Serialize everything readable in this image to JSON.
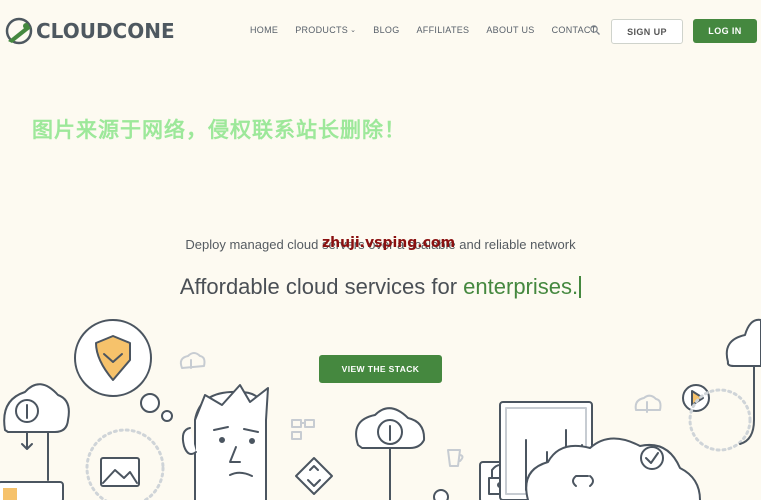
{
  "brand": {
    "name": "CLOUDCONE"
  },
  "nav": {
    "items": [
      "HOME",
      "PRODUCTS",
      "BLOG",
      "AFFILIATES",
      "ABOUT US",
      "CONTACT"
    ],
    "products_caret": "⌄",
    "search_icon": "search-icon",
    "signup_label": "SIGN UP",
    "login_label": "LOG IN"
  },
  "watermarks": {
    "cn_notice": "图片来源于网络，侵权联系站长删除！",
    "site_url": "zhuji.vsping.com"
  },
  "hero": {
    "tagline": "Deploy managed cloud servers over a scalable and reliable network",
    "headline_prefix": "Affordable cloud services for ",
    "headline_accent": "enterprises.",
    "cta_label": "VIEW THE STACK"
  },
  "colors": {
    "background": "#fdfaf1",
    "brand_green": "#45883f",
    "watermark_green": "#9de89a",
    "watermark_red": "#8a1010"
  }
}
